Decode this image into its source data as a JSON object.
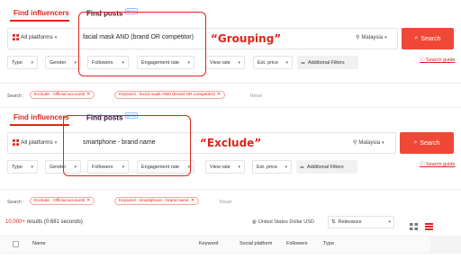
{
  "top": {
    "tabs": [
      {
        "label": "Find influencers"
      },
      {
        "label": "Find posts",
        "badge": "BETA"
      }
    ],
    "platform": "All platforms",
    "query": "facial mask AND (brand OR competitor)",
    "country": "Malaysia",
    "search_button": "Search",
    "search_guide": "Search guide",
    "filters": [
      "Type",
      "Gender",
      "Followers",
      "Engagement rate",
      "View rate",
      "Est. price"
    ],
    "additional_filters": "Additional Filters",
    "search_label": "Search :",
    "chips": [
      "Exclude : Official accounts",
      "Keyword : facial mask AND (brand OR competitor)"
    ],
    "reset": "Reset",
    "annotation": "“Grouping”"
  },
  "bottom": {
    "tabs": [
      {
        "label": "Find influencers"
      },
      {
        "label": "Find posts",
        "badge": "BETA"
      }
    ],
    "platform": "All platforms",
    "query": "smartphone - brand name",
    "country": "Malaysia",
    "search_button": "Search",
    "search_guide": "Search guide",
    "filters": [
      "Type",
      "Gender",
      "Followers",
      "Engagement rate",
      "View rate",
      "Est. price"
    ],
    "additional_filters": "Additional Filters",
    "search_label": "Search :",
    "chips": [
      "Exclude : Official accounts",
      "Keyword : smartphone - brand name"
    ],
    "reset": "Reset",
    "annotation": "“Exclude”"
  },
  "results": {
    "count": "10,000+",
    "text": " results (0.681 seconds)",
    "currency": "United States Dollar USD",
    "sort": "Relevance"
  },
  "table": {
    "headers": [
      "Name",
      "Keyword",
      "Social platform",
      "Followers",
      "Type"
    ]
  },
  "icons": {
    "platform": "grid-icon",
    "country": "location-pin-icon",
    "search": "search-icon",
    "filters": "sliders-icon",
    "chevron": "chevron-down-icon",
    "close": "close-icon",
    "currency": "globe-icon",
    "sort": "sort-icon",
    "view": "view-toggle-icon"
  },
  "colors": {
    "accent": "#e2231a",
    "button": "#ef4836",
    "annotation": "#e2231a"
  }
}
